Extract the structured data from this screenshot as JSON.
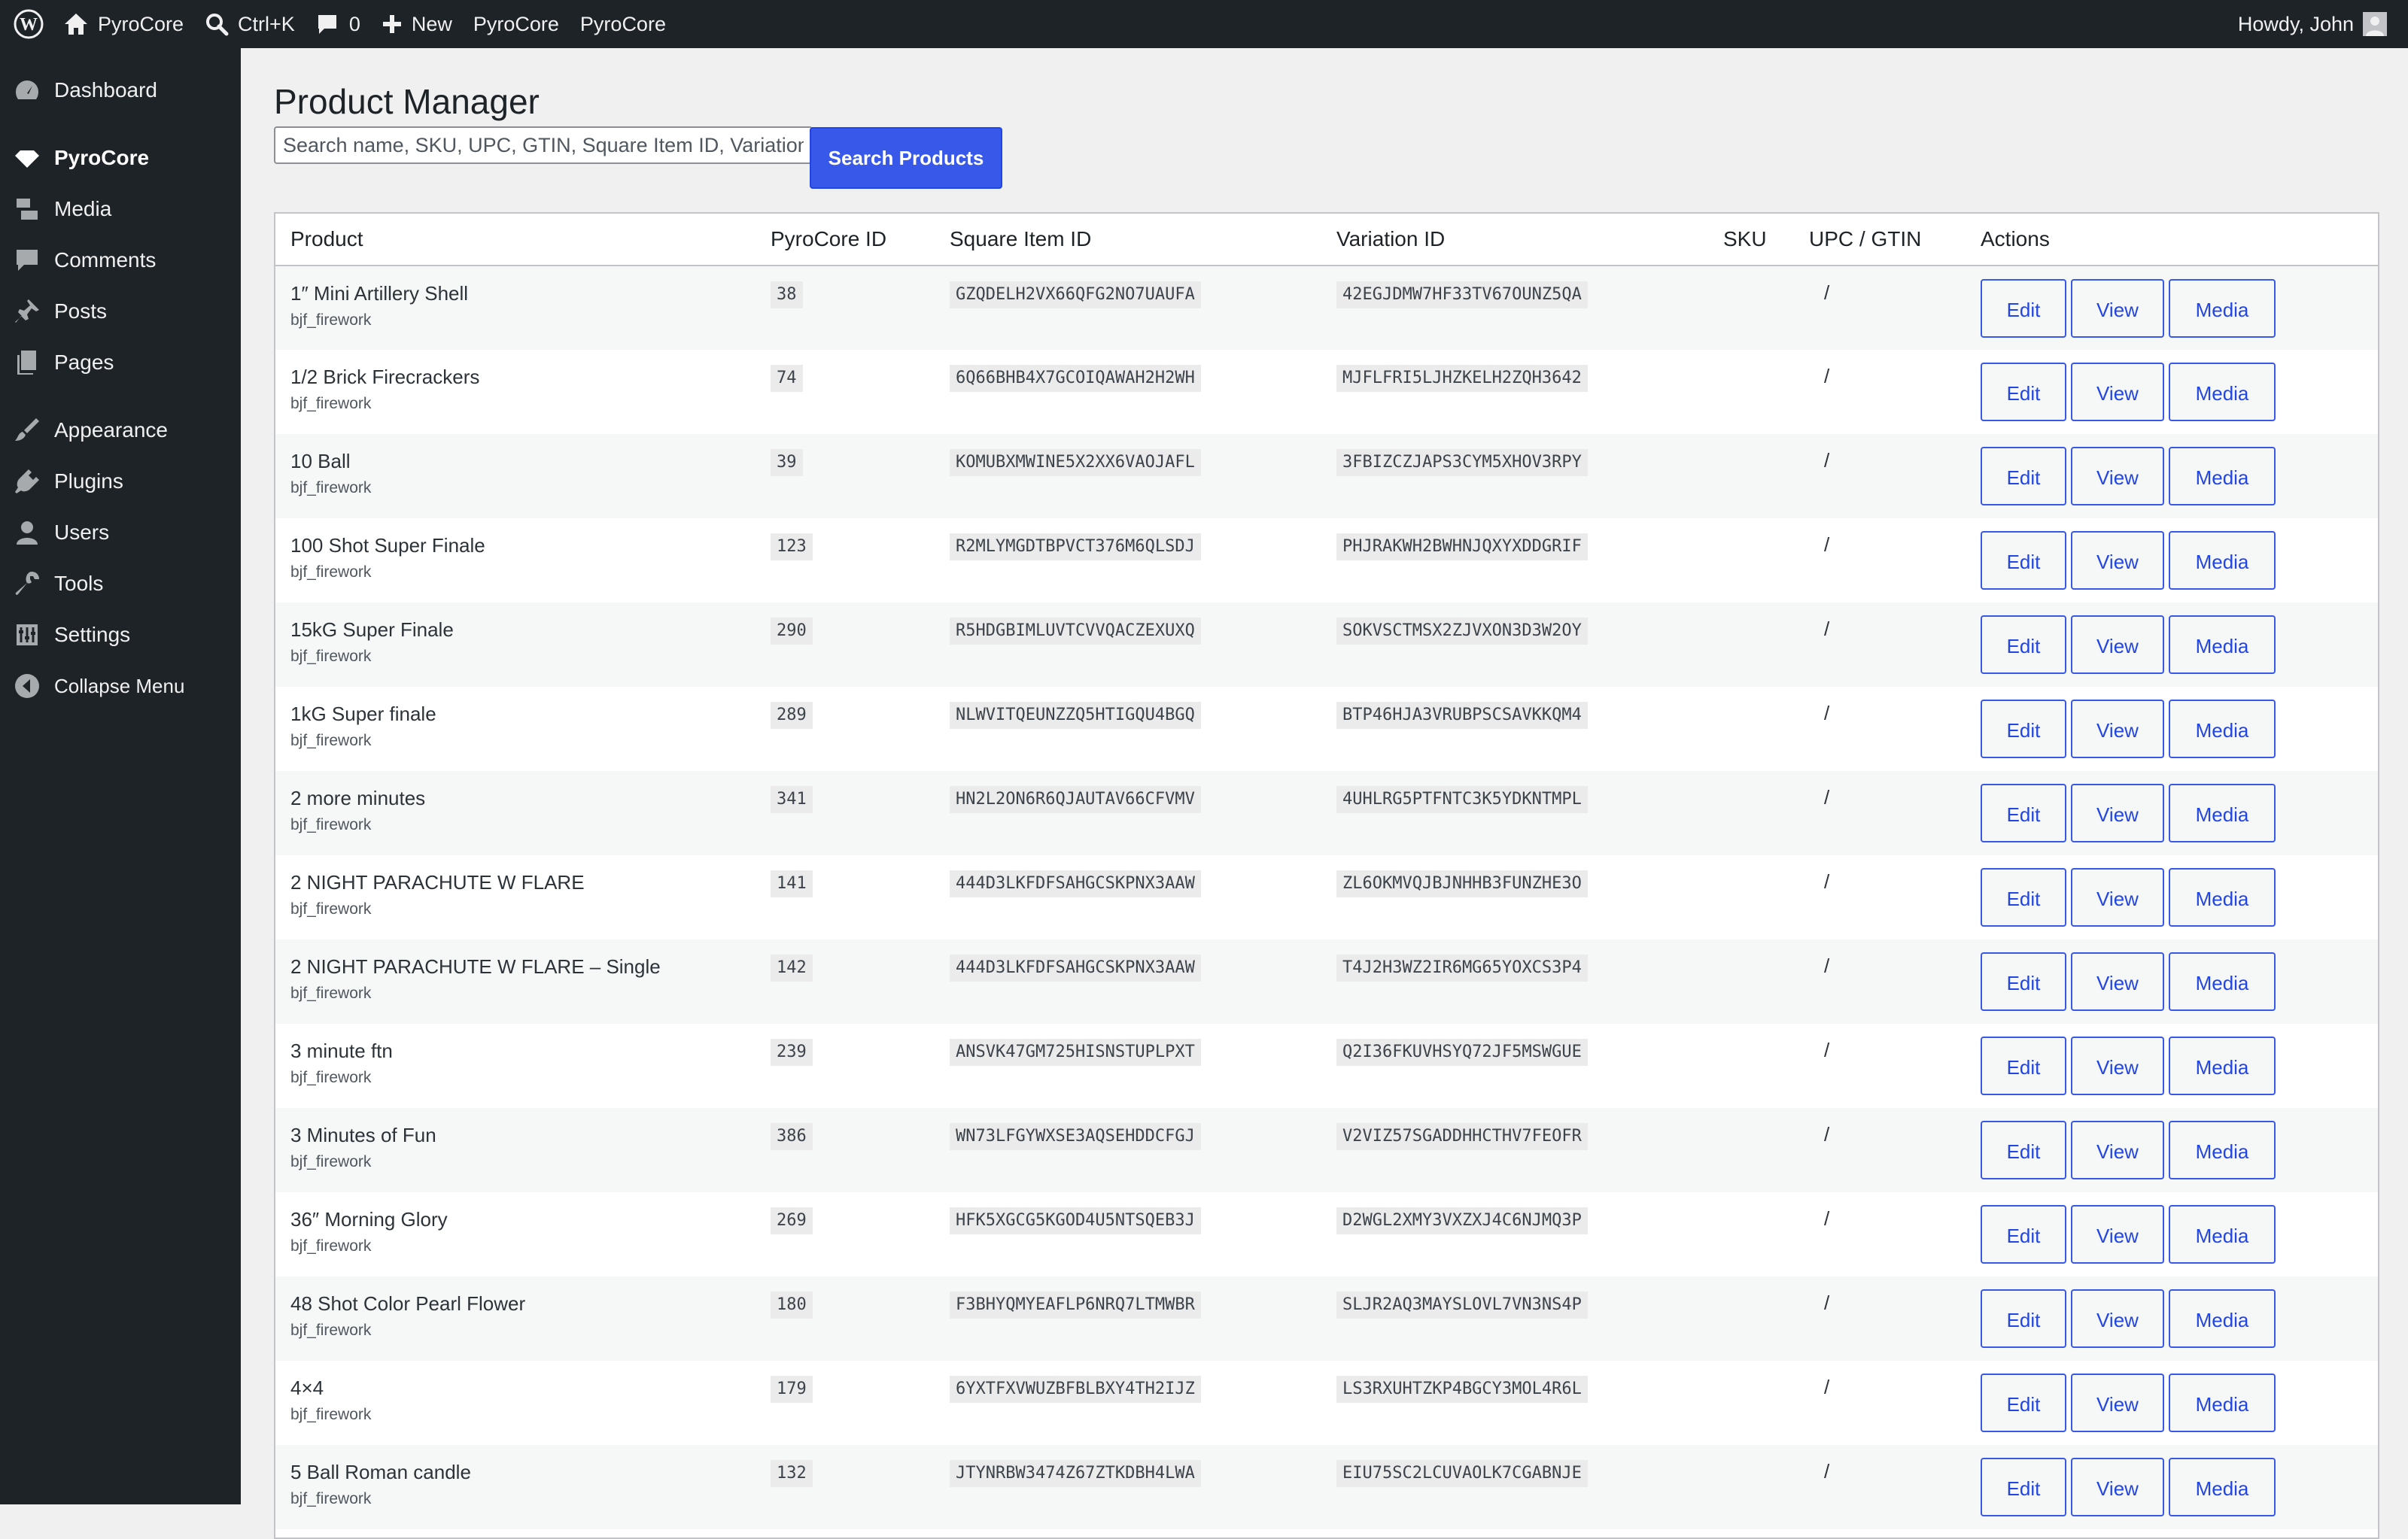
{
  "adminbar": {
    "wp_logo_icon": "wordpress-logo-icon",
    "site_name": "PyroCore",
    "search_shortcut": "Ctrl+K",
    "comments_count": "0",
    "new_label": "New",
    "link1": "PyroCore",
    "link2": "PyroCore",
    "howdy": "Howdy, John"
  },
  "sidebar": {
    "items": [
      {
        "label": "Dashboard",
        "icon": "dashboard-icon"
      },
      {
        "label": "PyroCore",
        "icon": "diamond-icon"
      },
      {
        "label": "Media",
        "icon": "media-icon"
      },
      {
        "label": "Comments",
        "icon": "comment-icon"
      },
      {
        "label": "Posts",
        "icon": "pin-icon"
      },
      {
        "label": "Pages",
        "icon": "pages-icon"
      },
      {
        "label": "Appearance",
        "icon": "brush-icon"
      },
      {
        "label": "Plugins",
        "icon": "plugin-icon"
      },
      {
        "label": "Users",
        "icon": "user-icon"
      },
      {
        "label": "Tools",
        "icon": "wrench-icon"
      },
      {
        "label": "Settings",
        "icon": "settings-icon"
      },
      {
        "label": "Collapse Menu",
        "icon": "collapse-icon"
      }
    ]
  },
  "page": {
    "title": "Product Manager",
    "search_placeholder": "Search name, SKU, UPC, GTIN, Square Item ID, Variation ID",
    "search_button": "Search Products"
  },
  "table": {
    "headers": [
      "Product",
      "PyroCore ID",
      "Square Item ID",
      "Variation ID",
      "SKU",
      "UPC / GTIN",
      "Actions"
    ],
    "action_labels": {
      "edit": "Edit",
      "view": "View",
      "media": "Media"
    },
    "rows": [
      {
        "name": "1″ Mini Artillery Shell",
        "type": "bjf_firework",
        "id": "38",
        "square": "GZQDELH2VX66QFG2NO7UAUFA",
        "variation": "42EGJDMW7HF33TV67OUNZ5QA",
        "sku": "",
        "upc": "/"
      },
      {
        "name": "1/2 Brick Firecrackers",
        "type": "bjf_firework",
        "id": "74",
        "square": "6Q66BHB4X7GCOIQAWAH2H2WH",
        "variation": "MJFLFRI5LJHZKELH2ZQH3642",
        "sku": "",
        "upc": "/"
      },
      {
        "name": "10 Ball",
        "type": "bjf_firework",
        "id": "39",
        "square": "KOMUBXMWINE5X2XX6VAOJAFL",
        "variation": "3FBIZCZJAPS3CYM5XHOV3RPY",
        "sku": "",
        "upc": "/"
      },
      {
        "name": "100 Shot Super Finale",
        "type": "bjf_firework",
        "id": "123",
        "square": "R2MLYMGDTBPVCT376M6QLSDJ",
        "variation": "PHJRAKWH2BWHNJQXYXDDGRIF",
        "sku": "",
        "upc": "/"
      },
      {
        "name": "15kG Super Finale",
        "type": "bjf_firework",
        "id": "290",
        "square": "R5HDGBIMLUVTCVVQACZEXUXQ",
        "variation": "SOKVSCTMSX2ZJVXON3D3W2OY",
        "sku": "",
        "upc": "/"
      },
      {
        "name": "1kG Super finale",
        "type": "bjf_firework",
        "id": "289",
        "square": "NLWVITQEUNZZQ5HTIGQU4BGQ",
        "variation": "BTP46HJA3VRUBPSCSAVKKQM4",
        "sku": "",
        "upc": "/"
      },
      {
        "name": "2 more minutes",
        "type": "bjf_firework",
        "id": "341",
        "square": "HN2L2ON6R6QJAUTAV66CFVMV",
        "variation": "4UHLRG5PTFNTC3K5YDKNTMPL",
        "sku": "",
        "upc": "/"
      },
      {
        "name": "2 NIGHT PARACHUTE W FLARE",
        "type": "bjf_firework",
        "id": "141",
        "square": "444D3LKFDFSAHGCSKPNX3AAW",
        "variation": "ZL6OKMVQJBJNHHB3FUNZHE3O",
        "sku": "",
        "upc": "/"
      },
      {
        "name": "2 NIGHT PARACHUTE W FLARE – Single",
        "type": "bjf_firework",
        "id": "142",
        "square": "444D3LKFDFSAHGCSKPNX3AAW",
        "variation": "T4J2H3WZ2IR6MG65YOXCS3P4",
        "sku": "",
        "upc": "/"
      },
      {
        "name": "3 minute ftn",
        "type": "bjf_firework",
        "id": "239",
        "square": "ANSVK47GM725HISNSTUPLPXT",
        "variation": "Q2I36FKUVHSYQ72JF5MSWGUE",
        "sku": "",
        "upc": "/"
      },
      {
        "name": "3 Minutes of Fun",
        "type": "bjf_firework",
        "id": "386",
        "square": "WN73LFGYWXSE3AQSEHDDCFGJ",
        "variation": "V2VIZ57SGADDHHCTHV7FEOFR",
        "sku": "",
        "upc": "/"
      },
      {
        "name": "36″ Morning Glory",
        "type": "bjf_firework",
        "id": "269",
        "square": "HFK5XGCG5KGOD4U5NTSQEB3J",
        "variation": "D2WGL2XMY3VXZXJ4C6NJMQ3P",
        "sku": "",
        "upc": "/"
      },
      {
        "name": "48 Shot Color Pearl Flower",
        "type": "bjf_firework",
        "id": "180",
        "square": "F3BHYQMYEAFLP6NRQ7LTMWBR",
        "variation": "SLJR2AQ3MAYSLOVL7VN3NS4P",
        "sku": "",
        "upc": "/"
      },
      {
        "name": "4×4",
        "type": "bjf_firework",
        "id": "179",
        "square": "6YXTFXVWUZBFBLBXY4TH2IJZ",
        "variation": "LS3RXUHTZKP4BGCY3MOL4R6L",
        "sku": "",
        "upc": "/"
      },
      {
        "name": "5 Ball Roman candle",
        "type": "bjf_firework",
        "id": "132",
        "square": "JTYNRBW3474Z67ZTKDBH4LWA",
        "variation": "EIU75SC2LCUVAOLK7CGABNJE",
        "sku": "",
        "upc": "/"
      }
    ]
  }
}
